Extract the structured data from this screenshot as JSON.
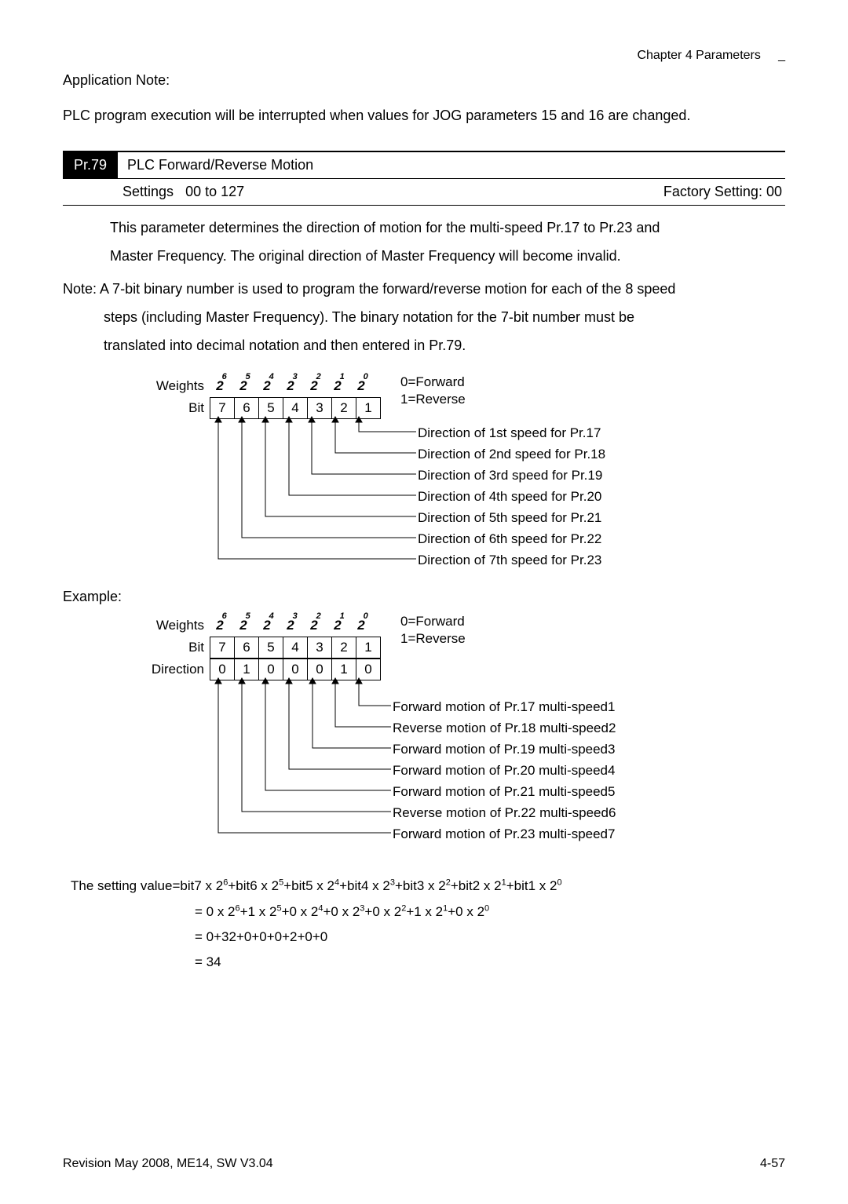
{
  "header": {
    "chapter": "Chapter 4 Parameters",
    "underscore": "_"
  },
  "app_note": {
    "title": "Application Note:",
    "text": "PLC program execution will be interrupted when values for JOG parameters 15 and 16 are changed."
  },
  "param": {
    "number": "Pr.79",
    "title": "PLC Forward/Reverse Motion",
    "settings_label": "Settings",
    "settings_range": "00 to 127",
    "factory_label": "Factory Setting:",
    "factory_value": "00"
  },
  "param_desc": {
    "line1": "This parameter determines the direction of motion for the multi-speed Pr.17 to Pr.23 and",
    "line2": "Master Frequency. The original direction of Master Frequency will become invalid."
  },
  "note": {
    "prefix": "Note:",
    "line1": "A 7-bit binary number is used to program the forward/reverse motion for each of the 8 speed",
    "line2": "steps (including Master Frequency). The binary notation for the 7-bit number must be",
    "line3": "translated into decimal notation and then entered in Pr.79."
  },
  "diagram1": {
    "weights_label": "Weights",
    "bit_label": "Bit",
    "weights": [
      "6",
      "5",
      "4",
      "3",
      "2",
      "1",
      "0"
    ],
    "bits": [
      "7",
      "6",
      "5",
      "4",
      "3",
      "2",
      "1"
    ],
    "legend_fwd": "0=Forward",
    "legend_rev": "1=Reverse",
    "descs": [
      "Direction of 1st speed for Pr.17",
      "Direction of 2nd speed for Pr.18",
      "Direction of 3rd speed for Pr.19",
      "Direction of 4th speed for Pr.20",
      "Direction of 5th speed for Pr.21",
      "Direction of 6th speed for Pr.22",
      "Direction of 7th speed for Pr.23"
    ]
  },
  "example_label": "Example:",
  "diagram2": {
    "weights_label": "Weights",
    "bit_label": "Bit",
    "dir_label": "Direction",
    "weights": [
      "6",
      "5",
      "4",
      "3",
      "2",
      "1",
      "0"
    ],
    "bits": [
      "7",
      "6",
      "5",
      "4",
      "3",
      "2",
      "1"
    ],
    "dirs": [
      "0",
      "1",
      "0",
      "0",
      "0",
      "1",
      "0"
    ],
    "legend_fwd": "0=Forward",
    "legend_rev": "1=Reverse",
    "descs": [
      "Forward motion of  Pr.17 multi-speed1",
      "Reverse motion of  Pr.18 multi-speed2",
      "Forward motion of  Pr.19 multi-speed3",
      "Forward motion of  Pr.20 multi-speed4",
      "Forward motion of  Pr.21 multi-speed5",
      "Reverse motion of Pr.22 multi-speed6",
      "Forward motion of Pr.23 multi-speed7"
    ]
  },
  "calc": {
    "line1_prefix": "The setting value=bit7 x 2",
    "line2": "= 0 x 2⁶+1 x 2⁵+0 x 2⁴+0 x 2³+0 x 2²+1 x 2¹+0 x 2⁰",
    "line3": "= 0+32+0+0+0+2+0+0",
    "line4": "= 34"
  },
  "footer": {
    "left": "Revision May 2008, ME14, SW V3.04",
    "right": "4-57"
  }
}
